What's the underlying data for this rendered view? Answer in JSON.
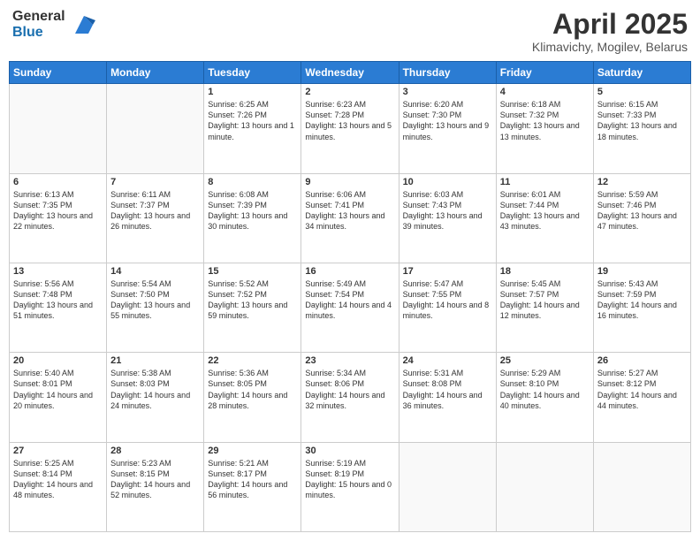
{
  "logo": {
    "general": "General",
    "blue": "Blue"
  },
  "title": {
    "month": "April 2025",
    "location": "Klimavichy, Mogilev, Belarus"
  },
  "weekdays": [
    "Sunday",
    "Monday",
    "Tuesday",
    "Wednesday",
    "Thursday",
    "Friday",
    "Saturday"
  ],
  "weeks": [
    [
      {
        "day": "",
        "info": ""
      },
      {
        "day": "",
        "info": ""
      },
      {
        "day": "1",
        "info": "Sunrise: 6:25 AM\nSunset: 7:26 PM\nDaylight: 13 hours and 1 minute."
      },
      {
        "day": "2",
        "info": "Sunrise: 6:23 AM\nSunset: 7:28 PM\nDaylight: 13 hours and 5 minutes."
      },
      {
        "day": "3",
        "info": "Sunrise: 6:20 AM\nSunset: 7:30 PM\nDaylight: 13 hours and 9 minutes."
      },
      {
        "day": "4",
        "info": "Sunrise: 6:18 AM\nSunset: 7:32 PM\nDaylight: 13 hours and 13 minutes."
      },
      {
        "day": "5",
        "info": "Sunrise: 6:15 AM\nSunset: 7:33 PM\nDaylight: 13 hours and 18 minutes."
      }
    ],
    [
      {
        "day": "6",
        "info": "Sunrise: 6:13 AM\nSunset: 7:35 PM\nDaylight: 13 hours and 22 minutes."
      },
      {
        "day": "7",
        "info": "Sunrise: 6:11 AM\nSunset: 7:37 PM\nDaylight: 13 hours and 26 minutes."
      },
      {
        "day": "8",
        "info": "Sunrise: 6:08 AM\nSunset: 7:39 PM\nDaylight: 13 hours and 30 minutes."
      },
      {
        "day": "9",
        "info": "Sunrise: 6:06 AM\nSunset: 7:41 PM\nDaylight: 13 hours and 34 minutes."
      },
      {
        "day": "10",
        "info": "Sunrise: 6:03 AM\nSunset: 7:43 PM\nDaylight: 13 hours and 39 minutes."
      },
      {
        "day": "11",
        "info": "Sunrise: 6:01 AM\nSunset: 7:44 PM\nDaylight: 13 hours and 43 minutes."
      },
      {
        "day": "12",
        "info": "Sunrise: 5:59 AM\nSunset: 7:46 PM\nDaylight: 13 hours and 47 minutes."
      }
    ],
    [
      {
        "day": "13",
        "info": "Sunrise: 5:56 AM\nSunset: 7:48 PM\nDaylight: 13 hours and 51 minutes."
      },
      {
        "day": "14",
        "info": "Sunrise: 5:54 AM\nSunset: 7:50 PM\nDaylight: 13 hours and 55 minutes."
      },
      {
        "day": "15",
        "info": "Sunrise: 5:52 AM\nSunset: 7:52 PM\nDaylight: 13 hours and 59 minutes."
      },
      {
        "day": "16",
        "info": "Sunrise: 5:49 AM\nSunset: 7:54 PM\nDaylight: 14 hours and 4 minutes."
      },
      {
        "day": "17",
        "info": "Sunrise: 5:47 AM\nSunset: 7:55 PM\nDaylight: 14 hours and 8 minutes."
      },
      {
        "day": "18",
        "info": "Sunrise: 5:45 AM\nSunset: 7:57 PM\nDaylight: 14 hours and 12 minutes."
      },
      {
        "day": "19",
        "info": "Sunrise: 5:43 AM\nSunset: 7:59 PM\nDaylight: 14 hours and 16 minutes."
      }
    ],
    [
      {
        "day": "20",
        "info": "Sunrise: 5:40 AM\nSunset: 8:01 PM\nDaylight: 14 hours and 20 minutes."
      },
      {
        "day": "21",
        "info": "Sunrise: 5:38 AM\nSunset: 8:03 PM\nDaylight: 14 hours and 24 minutes."
      },
      {
        "day": "22",
        "info": "Sunrise: 5:36 AM\nSunset: 8:05 PM\nDaylight: 14 hours and 28 minutes."
      },
      {
        "day": "23",
        "info": "Sunrise: 5:34 AM\nSunset: 8:06 PM\nDaylight: 14 hours and 32 minutes."
      },
      {
        "day": "24",
        "info": "Sunrise: 5:31 AM\nSunset: 8:08 PM\nDaylight: 14 hours and 36 minutes."
      },
      {
        "day": "25",
        "info": "Sunrise: 5:29 AM\nSunset: 8:10 PM\nDaylight: 14 hours and 40 minutes."
      },
      {
        "day": "26",
        "info": "Sunrise: 5:27 AM\nSunset: 8:12 PM\nDaylight: 14 hours and 44 minutes."
      }
    ],
    [
      {
        "day": "27",
        "info": "Sunrise: 5:25 AM\nSunset: 8:14 PM\nDaylight: 14 hours and 48 minutes."
      },
      {
        "day": "28",
        "info": "Sunrise: 5:23 AM\nSunset: 8:15 PM\nDaylight: 14 hours and 52 minutes."
      },
      {
        "day": "29",
        "info": "Sunrise: 5:21 AM\nSunset: 8:17 PM\nDaylight: 14 hours and 56 minutes."
      },
      {
        "day": "30",
        "info": "Sunrise: 5:19 AM\nSunset: 8:19 PM\nDaylight: 15 hours and 0 minutes."
      },
      {
        "day": "",
        "info": ""
      },
      {
        "day": "",
        "info": ""
      },
      {
        "day": "",
        "info": ""
      }
    ]
  ]
}
